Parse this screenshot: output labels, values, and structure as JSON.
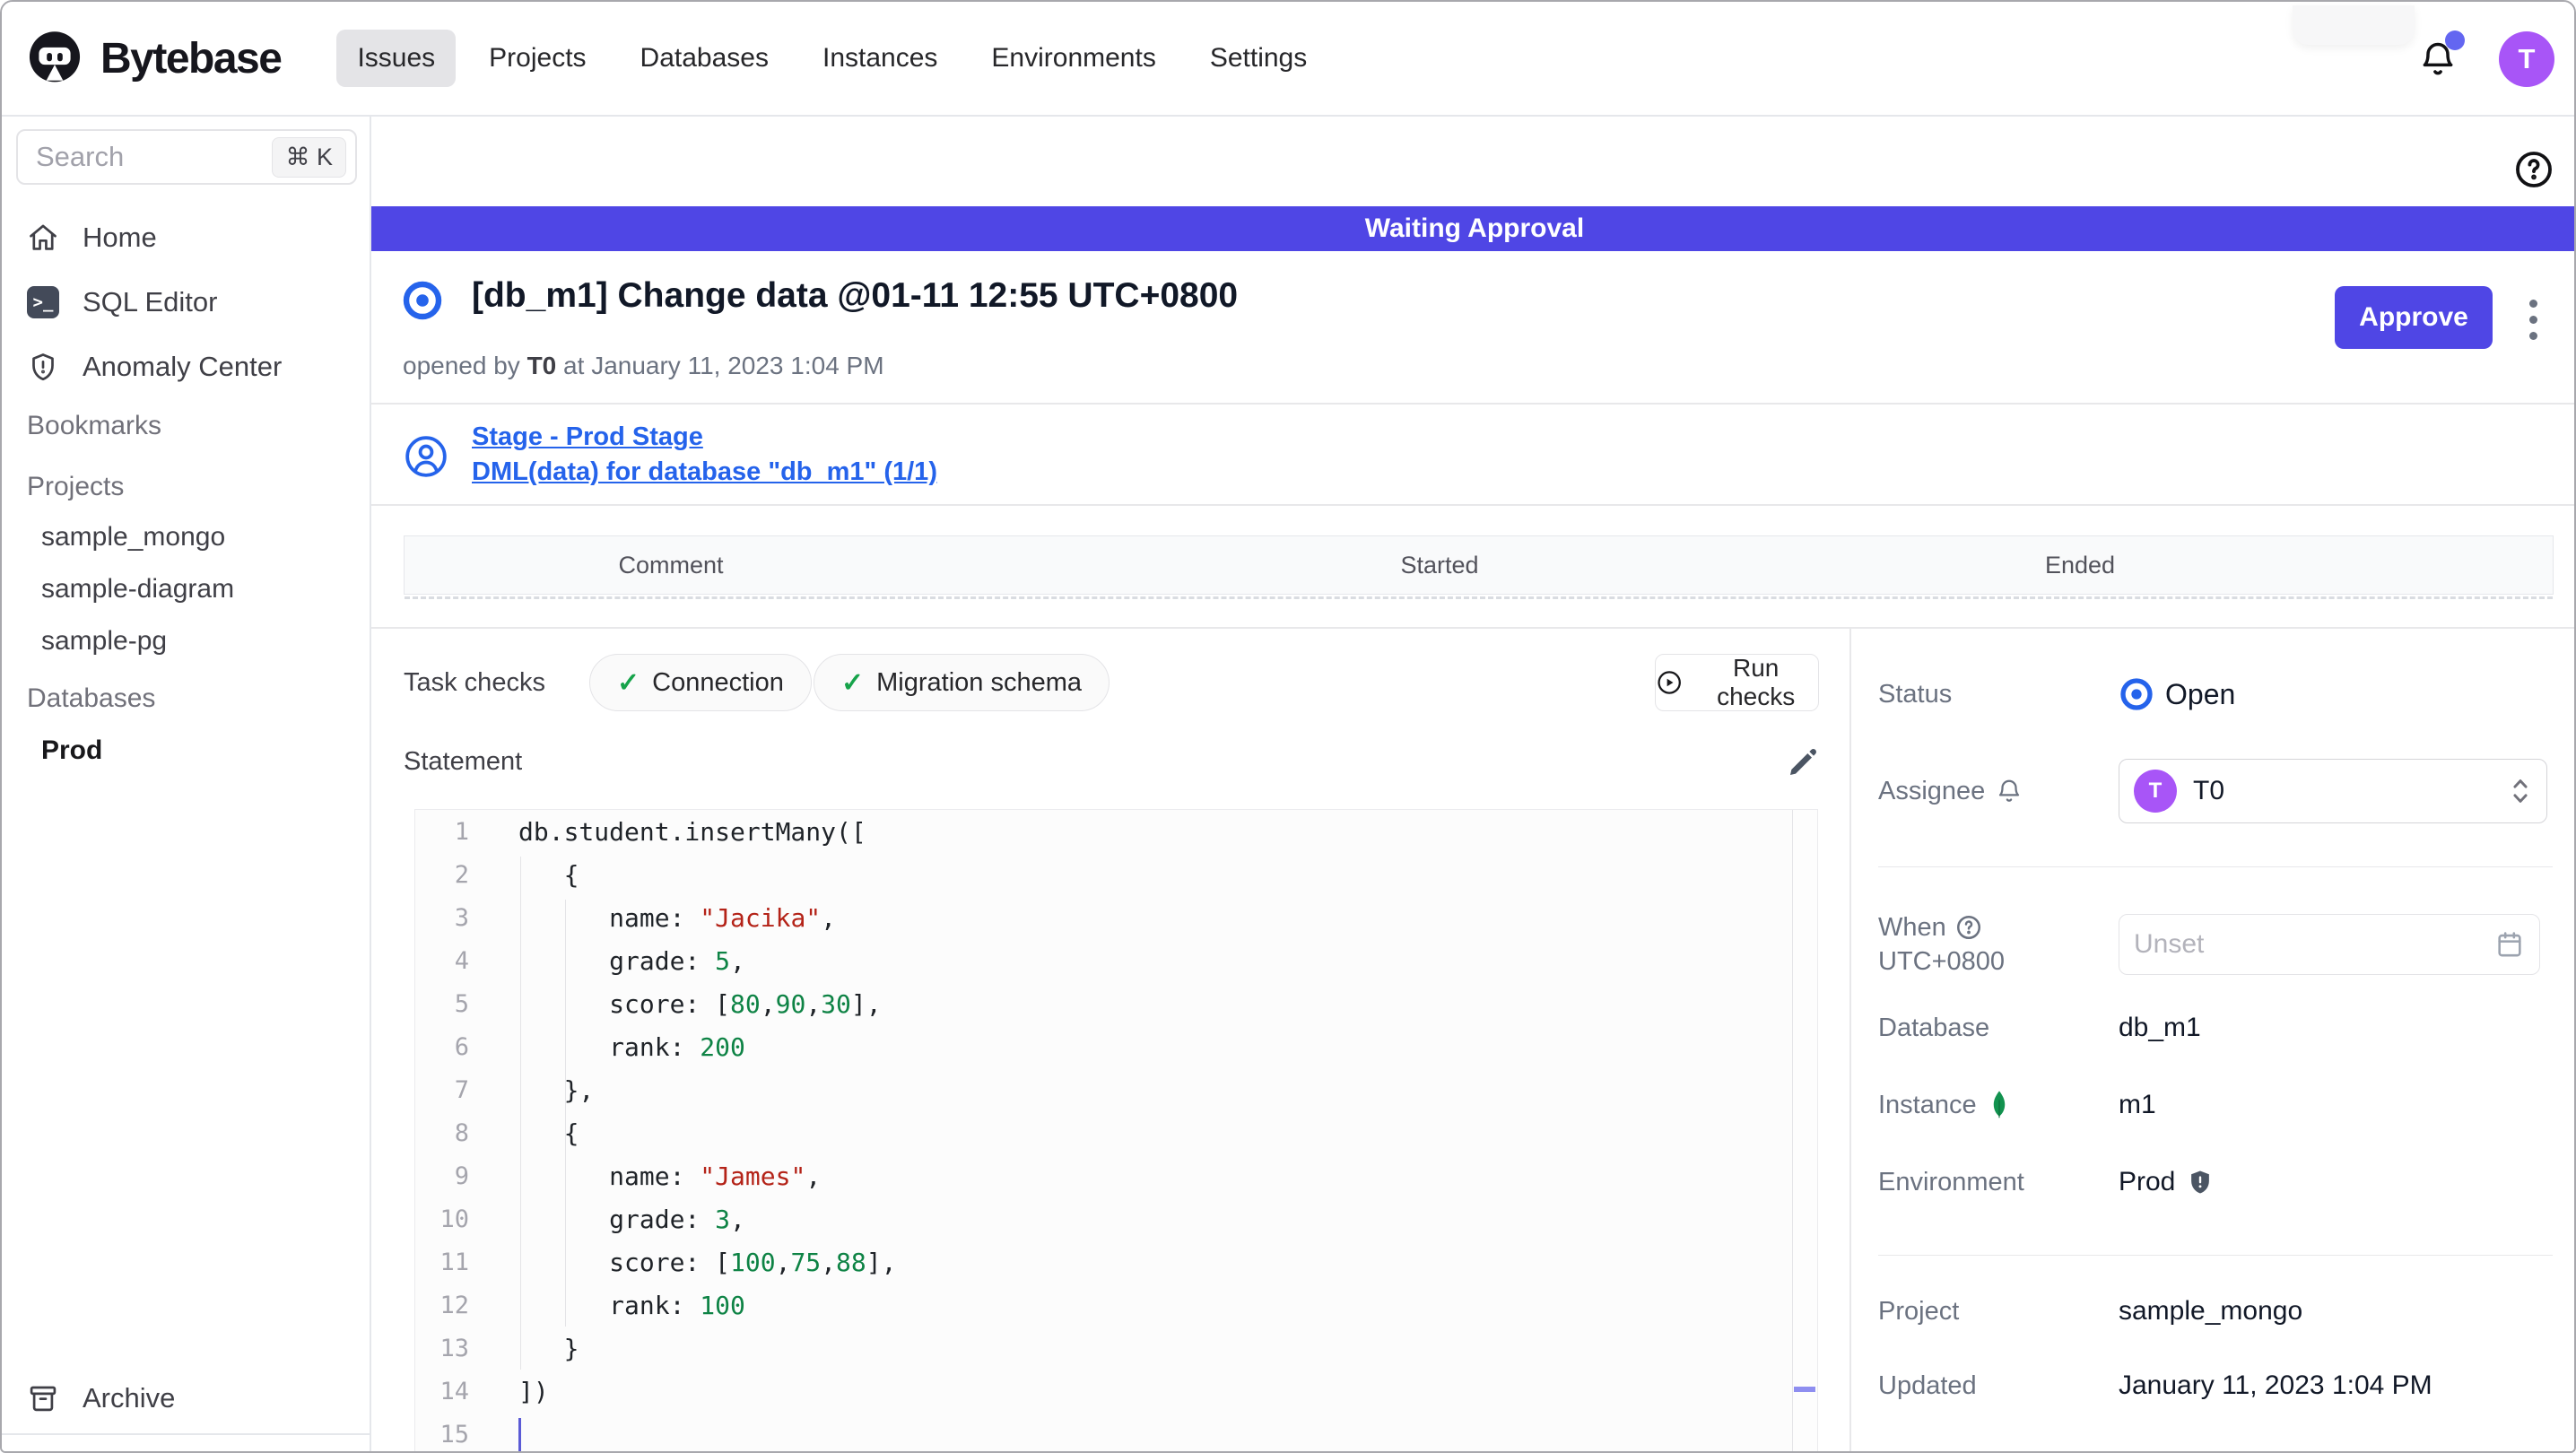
{
  "colors": {
    "accent_indigo": "#4f46e5",
    "link_blue": "#2563eb",
    "avatar_purple": "#a855f7",
    "check_green": "#16a34a",
    "code_string_red": "#b42318",
    "code_number_green": "#0e8345"
  },
  "nav": {
    "brand": "Bytebase",
    "items": [
      {
        "label": "Issues",
        "active": true
      },
      {
        "label": "Projects",
        "active": false
      },
      {
        "label": "Databases",
        "active": false
      },
      {
        "label": "Instances",
        "active": false
      },
      {
        "label": "Environments",
        "active": false
      },
      {
        "label": "Settings",
        "active": false
      }
    ],
    "avatar_initial": "T"
  },
  "sidebar": {
    "search": {
      "placeholder": "Search",
      "shortcut": "⌘ K"
    },
    "items": [
      {
        "label": "Home"
      },
      {
        "label": "SQL Editor"
      },
      {
        "label": "Anomaly Center"
      }
    ],
    "sql_icon_glyph": ">_",
    "sections": {
      "bookmarks_label": "Bookmarks",
      "projects_label": "Projects",
      "projects": [
        "sample_mongo",
        "sample-diagram",
        "sample-pg"
      ],
      "databases_label": "Databases",
      "databases": [
        "Prod"
      ]
    },
    "archive_label": "Archive"
  },
  "banner": {
    "text": "Waiting Approval"
  },
  "issue": {
    "title": "[db_m1] Change data @01-11 12:55 UTC+0800",
    "opened_prefix": "opened by ",
    "author": "T0",
    "opened_middle": " at ",
    "opened_at": "January 11, 2023 1:04 PM",
    "approve_label": "Approve"
  },
  "stage": {
    "stage_link": "Stage - Prod Stage",
    "task_link": "DML(data) for database \"db_m1\" (1/1)"
  },
  "task_table": {
    "headers": [
      "Comment",
      "Started",
      "Ended"
    ]
  },
  "checks": {
    "label": "Task checks",
    "items": [
      "Connection",
      "Migration schema"
    ],
    "check_glyph": "✓",
    "run_label": "Run checks"
  },
  "statement": {
    "label": "Statement",
    "lines": [
      {
        "segs": [
          [
            "db.student.insertMany([",
            "p"
          ]
        ]
      },
      {
        "segs": [
          [
            "   {",
            "p"
          ]
        ]
      },
      {
        "segs": [
          [
            "      name: ",
            "p"
          ],
          [
            "\"Jacika\"",
            "s"
          ],
          [
            ",",
            "p"
          ]
        ]
      },
      {
        "segs": [
          [
            "      grade: ",
            "p"
          ],
          [
            "5",
            "n"
          ],
          [
            ",",
            "p"
          ]
        ]
      },
      {
        "segs": [
          [
            "      score: [",
            "p"
          ],
          [
            "80",
            "n"
          ],
          [
            ",",
            "p"
          ],
          [
            "90",
            "n"
          ],
          [
            ",",
            "p"
          ],
          [
            "30",
            "n"
          ],
          [
            "],",
            "p"
          ]
        ]
      },
      {
        "segs": [
          [
            "      rank: ",
            "p"
          ],
          [
            "200",
            "n"
          ]
        ]
      },
      {
        "segs": [
          [
            "   },",
            "p"
          ]
        ]
      },
      {
        "segs": [
          [
            "   {",
            "p"
          ]
        ]
      },
      {
        "segs": [
          [
            "      name: ",
            "p"
          ],
          [
            "\"James\"",
            "s"
          ],
          [
            ",",
            "p"
          ]
        ]
      },
      {
        "segs": [
          [
            "      grade: ",
            "p"
          ],
          [
            "3",
            "n"
          ],
          [
            ",",
            "p"
          ]
        ]
      },
      {
        "segs": [
          [
            "      score: [",
            "p"
          ],
          [
            "100",
            "n"
          ],
          [
            ",",
            "p"
          ],
          [
            "75",
            "n"
          ],
          [
            ",",
            "p"
          ],
          [
            "88",
            "n"
          ],
          [
            "],",
            "p"
          ]
        ]
      },
      {
        "segs": [
          [
            "      rank: ",
            "p"
          ],
          [
            "100",
            "n"
          ]
        ]
      },
      {
        "segs": [
          [
            "   }",
            "p"
          ]
        ]
      },
      {
        "segs": [
          [
            "])",
            "p"
          ]
        ]
      },
      {
        "segs": [],
        "cursor": true
      }
    ]
  },
  "details": {
    "status_label": "Status",
    "status_value": "Open",
    "assignee_label": "Assignee",
    "assignee_value": "T0",
    "assignee_initial": "T",
    "when_label": "When",
    "when_tz": "UTC+0800",
    "when_placeholder": "Unset",
    "database_label": "Database",
    "database_value": "db_m1",
    "instance_label": "Instance",
    "instance_value": "m1",
    "environment_label": "Environment",
    "environment_value": "Prod",
    "project_label": "Project",
    "project_value": "sample_mongo",
    "updated_label": "Updated",
    "updated_value": "January 11, 2023 1:04 PM"
  }
}
